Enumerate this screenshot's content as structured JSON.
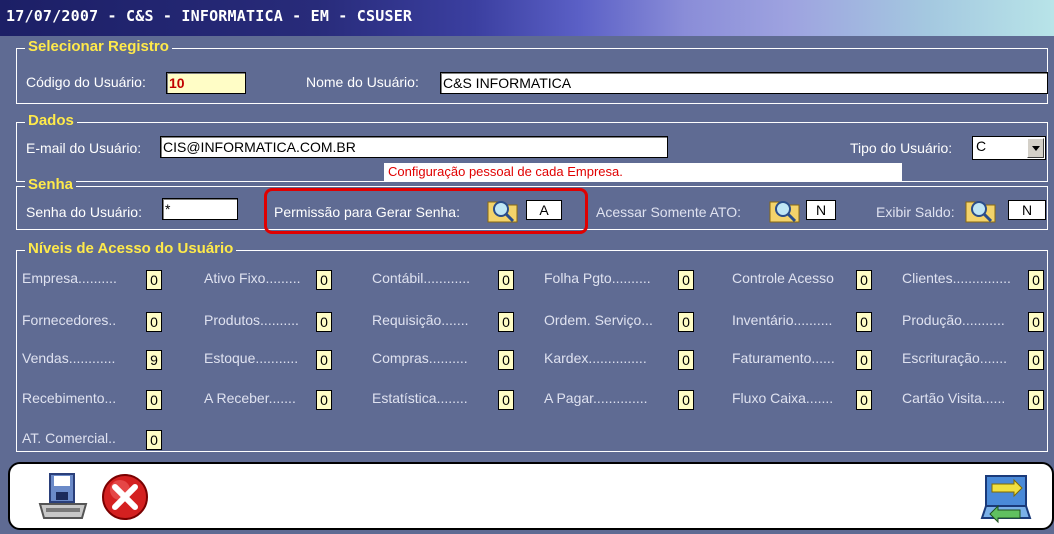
{
  "window": {
    "title": "17/07/2007 - C&S - INFORMATICA - EM - CSUSER"
  },
  "selecionar": {
    "legend": "Selecionar Registro",
    "codigo_label": "Código do Usuário:",
    "codigo_value": "10",
    "nome_label": "Nome do Usuário:",
    "nome_value": "C&S INFORMATICA"
  },
  "dados": {
    "legend": "Dados",
    "email_label": "E-mail do Usuário:",
    "email_value": "CIS@INFORMATICA.COM.BR",
    "tipo_label": "Tipo do Usuário:",
    "tipo_value": "C",
    "note": "Configuração pessoal de cada Empresa."
  },
  "senha": {
    "legend": "Senha",
    "senha_label": "Senha do Usuário:",
    "senha_value": "*",
    "permissao_label": "Permissão para Gerar Senha:",
    "permissao_value": "A",
    "ato_label": "Acessar Somente ATO:",
    "ato_value": "N",
    "saldo_label": "Exibir Saldo:",
    "saldo_value": "N"
  },
  "niveis": {
    "legend": "Níveis de Acesso do Usuário",
    "items": [
      {
        "label": "Empresa..........",
        "value": "0"
      },
      {
        "label": "Ativo Fixo.........",
        "value": "0"
      },
      {
        "label": "Contábil............",
        "value": "0"
      },
      {
        "label": "Folha Pgto..........",
        "value": "0"
      },
      {
        "label": "Controle Acesso",
        "value": "0"
      },
      {
        "label": "Clientes...............",
        "value": "0"
      },
      {
        "label": "Fornecedores..",
        "value": "0"
      },
      {
        "label": "Produtos..........",
        "value": "0"
      },
      {
        "label": "Requisição.......",
        "value": "0"
      },
      {
        "label": "Ordem. Serviço...",
        "value": "0"
      },
      {
        "label": "Inventário..........",
        "value": "0"
      },
      {
        "label": "Produção...........",
        "value": "0"
      },
      {
        "label": "Vendas............",
        "value": "9"
      },
      {
        "label": "Estoque...........",
        "value": "0"
      },
      {
        "label": "Compras..........",
        "value": "0"
      },
      {
        "label": "Kardex...............",
        "value": "0"
      },
      {
        "label": "Faturamento......",
        "value": "0"
      },
      {
        "label": "Escrituração.......",
        "value": "0"
      },
      {
        "label": "Recebimento...",
        "value": "0"
      },
      {
        "label": "A Receber.......",
        "value": "0"
      },
      {
        "label": "Estatística........",
        "value": "0"
      },
      {
        "label": "A Pagar..............",
        "value": "0"
      },
      {
        "label": "Fluxo Caixa.......",
        "value": "0"
      },
      {
        "label": "Cartão Visita......",
        "value": "0"
      },
      {
        "label": "AT. Comercial..",
        "value": "0"
      }
    ]
  },
  "icons": {
    "save": "save-icon",
    "cancel": "cancel-icon",
    "exit": "exit-icon",
    "search": "search-icon"
  },
  "colors": {
    "panel": "#5f6b93",
    "legend": "#ffea4a",
    "value_box": "#fffdc6",
    "highlight": "#e00000"
  }
}
